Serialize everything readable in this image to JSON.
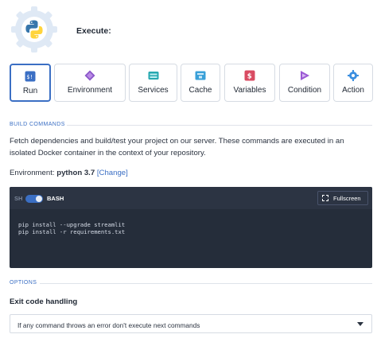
{
  "header": {
    "title": "Execute:",
    "logo_icon": "python-logo-in-gear"
  },
  "tiles": [
    {
      "label": "Run",
      "icon": "terminal-icon",
      "color": "#3b6fc4",
      "active": true
    },
    {
      "label": "Environment",
      "icon": "diamond-icon",
      "color": "#8a57c8",
      "active": false
    },
    {
      "label": "Services",
      "icon": "services-icon",
      "color": "#26a8b0",
      "active": false
    },
    {
      "label": "Cache",
      "icon": "cache-icon",
      "color": "#3aa0d8",
      "active": false
    },
    {
      "label": "Variables",
      "icon": "variables-icon",
      "color": "#d94b62",
      "active": false
    },
    {
      "label": "Condition",
      "icon": "play-icon",
      "color": "#9b59d4",
      "active": false
    },
    {
      "label": "Action",
      "icon": "gear-icon",
      "color": "#3b8fe0",
      "active": false
    }
  ],
  "build": {
    "section_title": "BUILD COMMANDS",
    "description": "Fetch dependencies and build/test your project on our server. These commands are executed in an isolated Docker container in the context of your repository.",
    "environment_label": "Environment:",
    "environment_value": "python 3.7",
    "change_link": "[Change]"
  },
  "editor": {
    "sh_label": "SH",
    "mode_label": "BASH",
    "fullscreen_label": "Fullscreen",
    "code_lines": [
      "pip install --upgrade streamlit",
      "pip install -r requirements.txt"
    ],
    "background": "#252d3a"
  },
  "options": {
    "section_title": "OPTIONS",
    "exit_code_heading": "Exit code handling",
    "exit_code_value": "If any command throws an error don't execute next commands"
  },
  "colors": {
    "accent": "#3b6fc4",
    "python_blue": "#3776ab",
    "python_yellow": "#ffd43b"
  }
}
